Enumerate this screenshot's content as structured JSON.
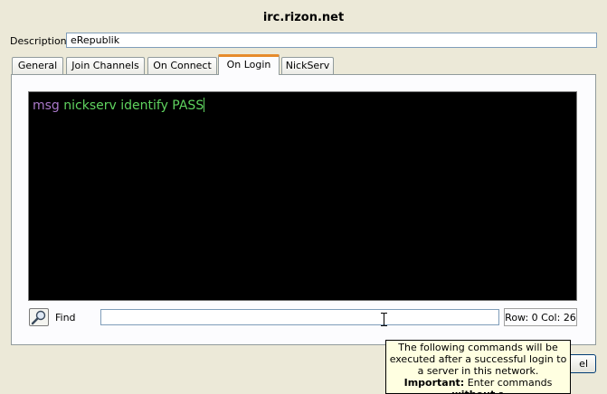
{
  "window": {
    "title": "irc.rizon.net"
  },
  "description": {
    "label": "Description:",
    "value": "eRepublik"
  },
  "tabs": [
    {
      "label": "General",
      "active": false
    },
    {
      "label": "Join Channels",
      "active": false
    },
    {
      "label": "On Connect",
      "active": false
    },
    {
      "label": "On Login",
      "active": true
    },
    {
      "label": "NickServ",
      "active": false
    }
  ],
  "editor": {
    "command_keyword": "msg",
    "command_args": "nickserv identify PASS",
    "keyword_color": "#a978c9",
    "text_color": "#5fd35f",
    "background": "#000000"
  },
  "find": {
    "icon": "magnifier-icon",
    "label": "Find",
    "value": ""
  },
  "status": {
    "row_col": "Row: 0 Col: 26"
  },
  "buttons": {
    "cancel_partial": "el"
  },
  "tooltip": {
    "line1": "The following commands will be executed after a successful login to a server in this network.",
    "important_label": "Important:",
    "line2_pre": "Enter commands",
    "line2_bold": "without",
    "line2_post": "a"
  }
}
